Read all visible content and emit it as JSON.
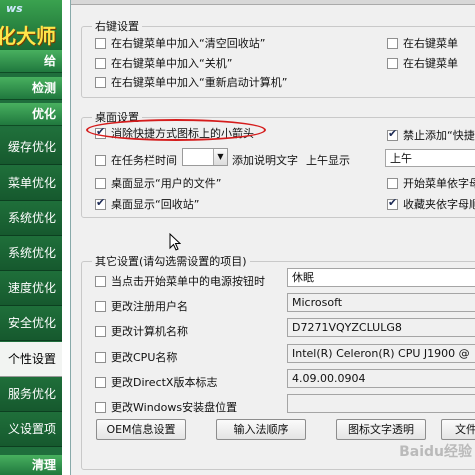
{
  "sidebar": {
    "logo_top": "ws",
    "logo_brand": "化大师",
    "items": [
      {
        "label": "给"
      },
      {
        "label": "检测"
      },
      {
        "label": "优化"
      },
      {
        "label": "缓存优化"
      },
      {
        "label": "菜单优化"
      },
      {
        "label": "系统优化"
      },
      {
        "label": "系统优化"
      },
      {
        "label": "速度优化"
      },
      {
        "label": "安全优化"
      },
      {
        "label": "个性设置"
      },
      {
        "label": "服务优化"
      },
      {
        "label": "义设置项"
      },
      {
        "label": "清理"
      }
    ]
  },
  "right_click": {
    "title": "右键设置",
    "options": [
      {
        "label": "在右键菜单中加入“清空回收站”",
        "checked": false
      },
      {
        "label": "在右键菜单中加入“关机”",
        "checked": false
      },
      {
        "label": "在右键菜单中加入“重新启动计算机”",
        "checked": false
      }
    ],
    "options_right": [
      {
        "label": "在右键菜单",
        "checked": false
      },
      {
        "label": "在右键菜单",
        "checked": false
      }
    ]
  },
  "desktop": {
    "title": "桌面设置",
    "remove_arrow": {
      "label": "消除快捷方式图标上的小箭头",
      "checked": true
    },
    "taskbar_time": {
      "label": "在任务栏时间",
      "checked": false,
      "combo_value": "",
      "suffix": "添加说明文字",
      "display_label": "上午显示",
      "display_value": "上午"
    },
    "user_files": {
      "label": "桌面显示“用户的文件”",
      "checked": false
    },
    "recycle_bin": {
      "label": "桌面显示“回收站”",
      "checked": true
    },
    "right_col": [
      {
        "label": "禁止添加“快捷",
        "checked": true
      },
      {
        "label": "开始菜单依字母",
        "checked": false
      },
      {
        "label": "收藏夹依字母顺",
        "checked": true
      }
    ]
  },
  "other": {
    "title": "其它设置(请勾选需设置的项目)",
    "rows": [
      {
        "label": "当点击开始菜单中的电源按钮时",
        "value": "休眠",
        "checked": false
      },
      {
        "label": "更改注册用户名",
        "value": "Microsoft",
        "checked": false
      },
      {
        "label": "更改计算机名称",
        "value": "D7271VQYZCLULG8",
        "checked": false
      },
      {
        "label": "更改CPU名称",
        "value": "Intel(R) Celeron(R) CPU  J1900  @",
        "checked": false
      },
      {
        "label": "更改DirectX版本标志",
        "value": "4.09.00.0904",
        "checked": false
      },
      {
        "label": "更改Windows安装盘位置",
        "value": "",
        "checked": false
      }
    ],
    "buttons": {
      "oem": "OEM信息设置",
      "ime": "输入法顺序",
      "icon_text": "图标文字透明",
      "file": "文件"
    }
  },
  "watermark": "Baidu经验"
}
